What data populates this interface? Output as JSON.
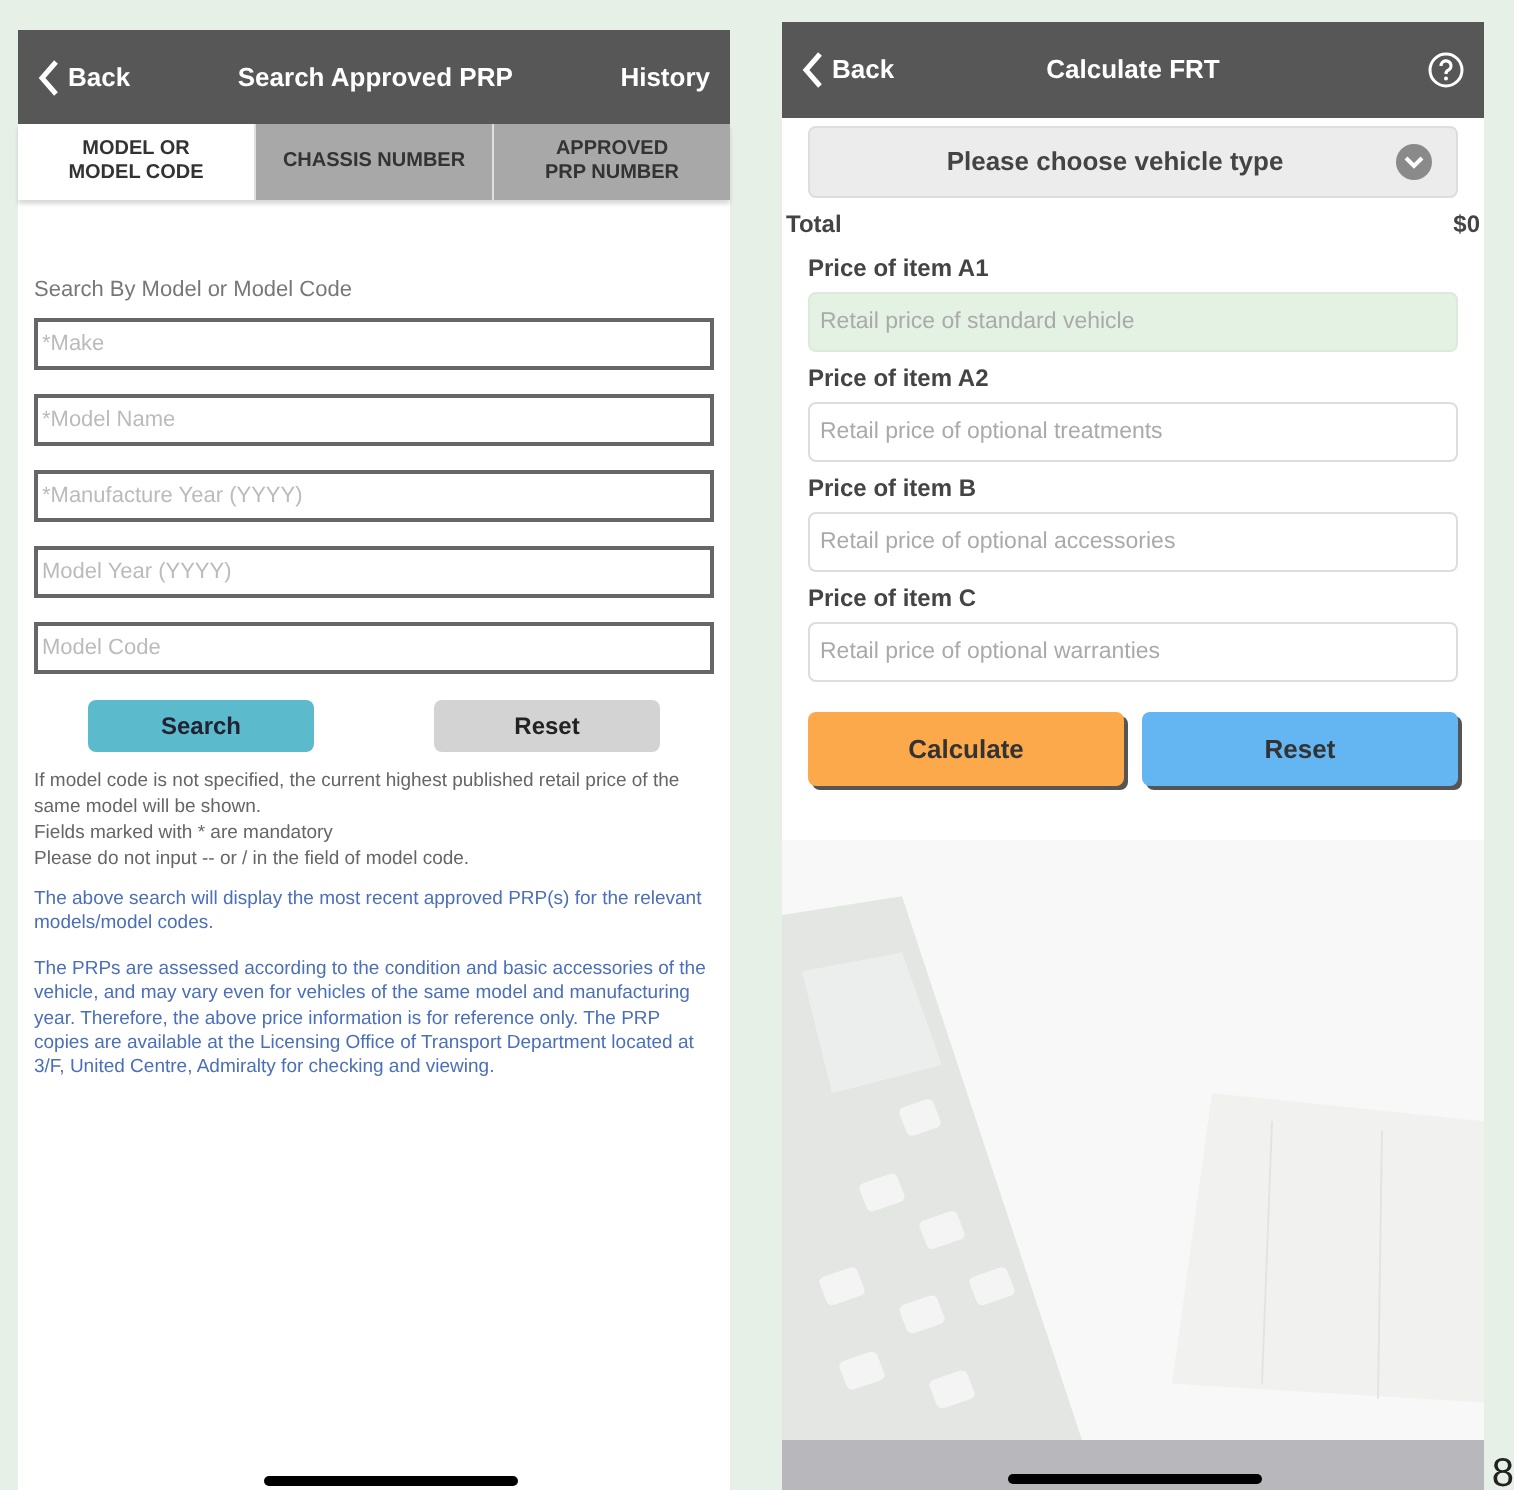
{
  "search_screen": {
    "back": "Back",
    "title": "Search Approved PRP",
    "history": "History",
    "tabs": [
      {
        "label": "MODEL OR\nMODEL CODE",
        "selected": true
      },
      {
        "label": "CHASSIS NUMBER",
        "selected": false
      },
      {
        "label": "APPROVED\nPRP NUMBER",
        "selected": false
      }
    ],
    "section_title": "Search By Model or Model Code",
    "fields": [
      {
        "placeholder": "*Make"
      },
      {
        "placeholder": "*Model Name"
      },
      {
        "placeholder": "*Manufacture Year (YYYY)"
      },
      {
        "placeholder": "Model Year (YYYY)"
      },
      {
        "placeholder": "Model Code"
      }
    ],
    "search_button": "Search",
    "reset_button": "Reset",
    "notes": [
      "If model code is not specified, the current highest published retail price of the same model will be shown.",
      "Fields marked with * are mandatory",
      "Please do not input -- or / in the field of model code."
    ],
    "info": [
      "The above search will display the most recent approved PRP(s) for the relevant models/model codes.",
      "The PRPs are assessed according to the condition and basic accessories of the vehicle, and may vary even for vehicles of the same model and manufacturing year. Therefore, the above price information is for reference only. The PRP copies are available at the Licensing Office of Transport Department located at 3/F, United Centre, Admiralty for checking and viewing."
    ]
  },
  "calculator_screen": {
    "back": "Back",
    "title": "Calculate FRT",
    "vehicle_type": {
      "placeholder": "Please choose vehicle type"
    },
    "total_label": "Total",
    "total_value": "$0",
    "items": [
      {
        "label": "Price of item A1",
        "placeholder": "Retail price of standard vehicle",
        "highlighted": true
      },
      {
        "label": "Price of item A2",
        "placeholder": "Retail price of optional treatments",
        "highlighted": false
      },
      {
        "label": "Price of item B",
        "placeholder": "Retail price of optional accessories",
        "highlighted": false
      },
      {
        "label": "Price of item C",
        "placeholder": "Retail price of optional warranties",
        "highlighted": false
      }
    ],
    "calculate_button": "Calculate",
    "reset_button": "Reset"
  },
  "page_number": "8"
}
